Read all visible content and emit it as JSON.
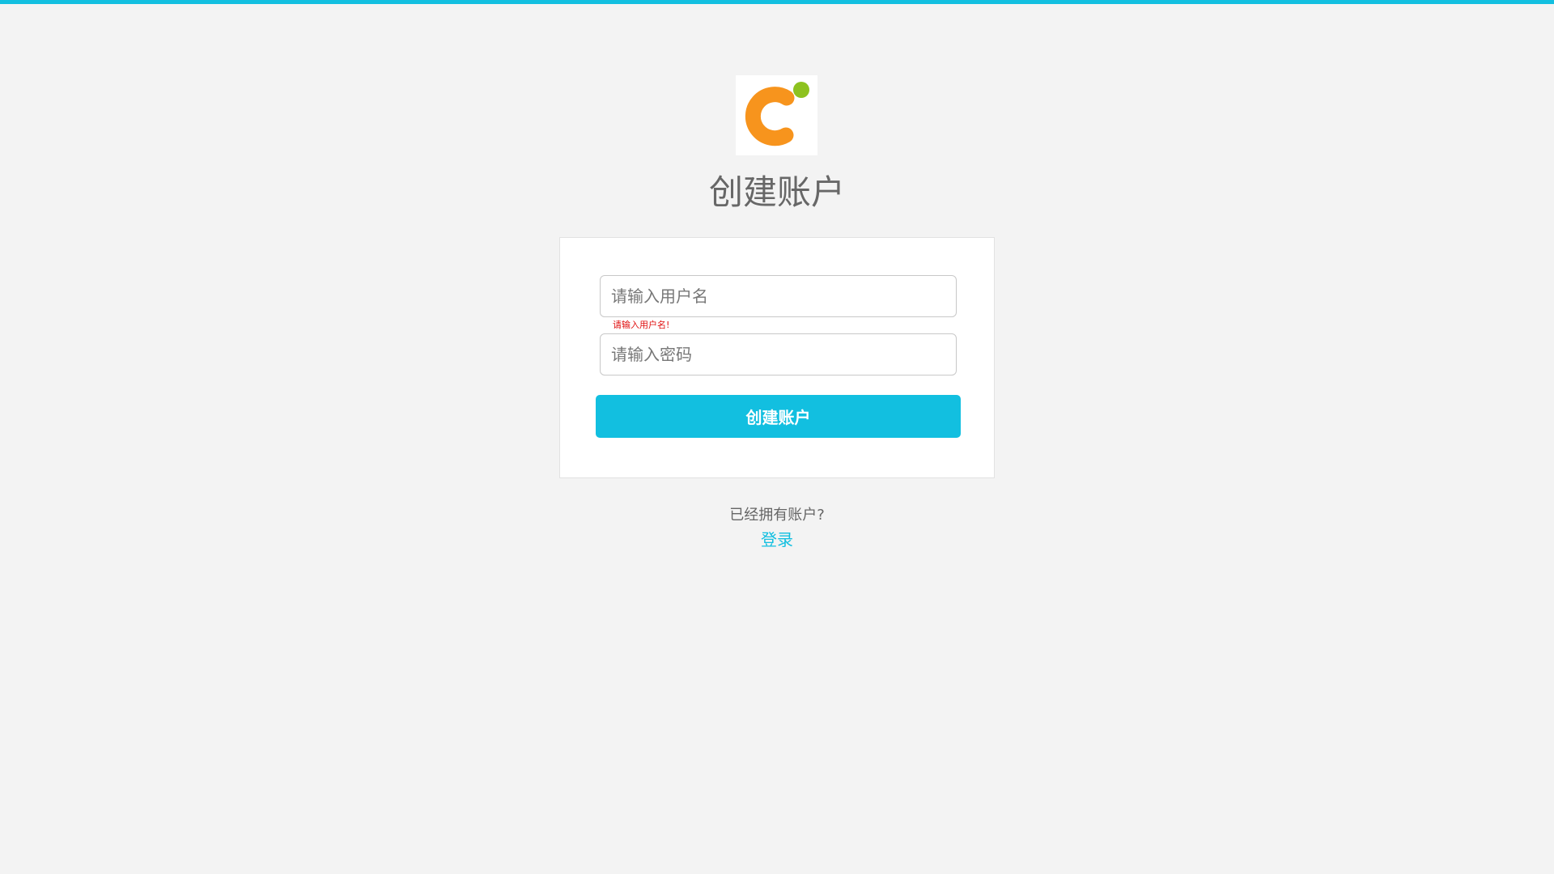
{
  "colors": {
    "accent": "#12bfe0",
    "logo_orange": "#f7941d",
    "logo_green": "#8dc21f",
    "error": "#e01010",
    "background": "#f3f3f3"
  },
  "logo": {
    "icon": "brand-c-logo-icon"
  },
  "page_title": "创建账户",
  "form": {
    "username_placeholder": "请输入用户名",
    "username_value": "",
    "username_error": "请输入用户名!",
    "password_placeholder": "请输入密码",
    "password_value": "",
    "submit_label": "创建账户"
  },
  "footer": {
    "question": "已经拥有账户?",
    "login_link": "登录"
  }
}
